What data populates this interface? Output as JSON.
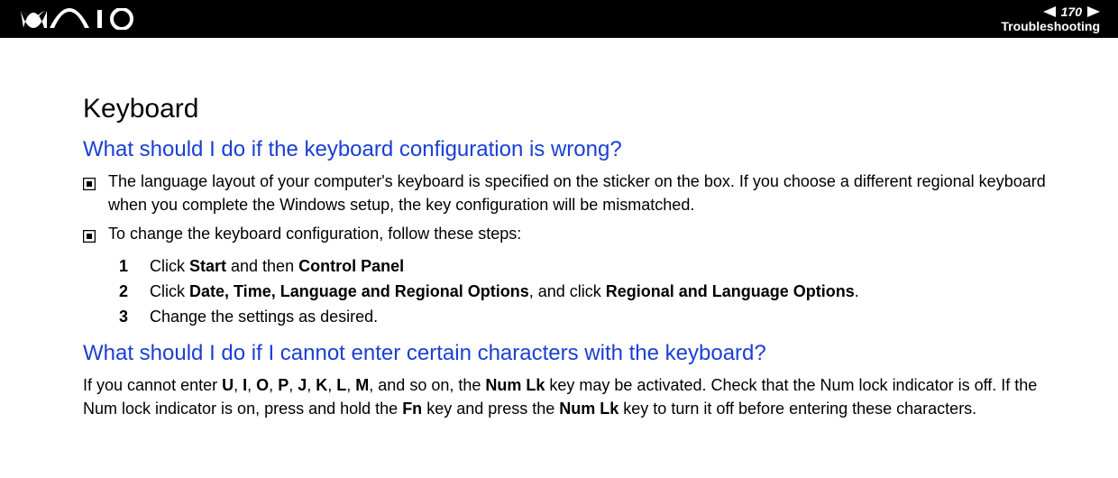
{
  "header": {
    "page_number": "170",
    "breadcrumb": "Troubleshooting"
  },
  "content": {
    "section_title": "Keyboard",
    "q1": {
      "question": "What should I do if the keyboard configuration is wrong?",
      "bullet1": "The language layout of your computer's keyboard is specified on the sticker on the box. If you choose a different regional keyboard when you complete the Windows setup, the key configuration will be mismatched.",
      "bullet2": "To change the keyboard configuration, follow these steps:",
      "steps": {
        "n1": "1",
        "s1_pre": "Click ",
        "s1_b1": "Start",
        "s1_mid": " and then ",
        "s1_b2": "Control Panel",
        "n2": "2",
        "s2_pre": "Click ",
        "s2_b1": "Date, Time, Language and Regional Options",
        "s2_mid": ", and click ",
        "s2_b2": "Regional and Language Options",
        "s2_suf": ".",
        "n3": "3",
        "s3": "Change the settings as desired."
      }
    },
    "q2": {
      "question": "What should I do if I cannot enter certain characters with the keyboard?",
      "p_pre": "If you cannot enter ",
      "kU": "U",
      "c1": ", ",
      "kI": "I",
      "c2": ", ",
      "kO": "O",
      "c3": ", ",
      "kP": "P",
      "c4": ", ",
      "kJ": "J",
      "c5": ", ",
      "kK": "K",
      "c6": ", ",
      "kL": "L",
      "c7": ", ",
      "kM": "M",
      "p_mid1": ", and so on, the ",
      "kNumLk1": "Num Lk",
      "p_mid2": " key may be activated. Check that the Num lock indicator is off. If the Num lock indicator is on, press and hold the ",
      "kFn": "Fn",
      "p_mid3": " key and press the ",
      "kNumLk2": "Num Lk",
      "p_suf": " key to turn it off before entering these characters."
    }
  }
}
